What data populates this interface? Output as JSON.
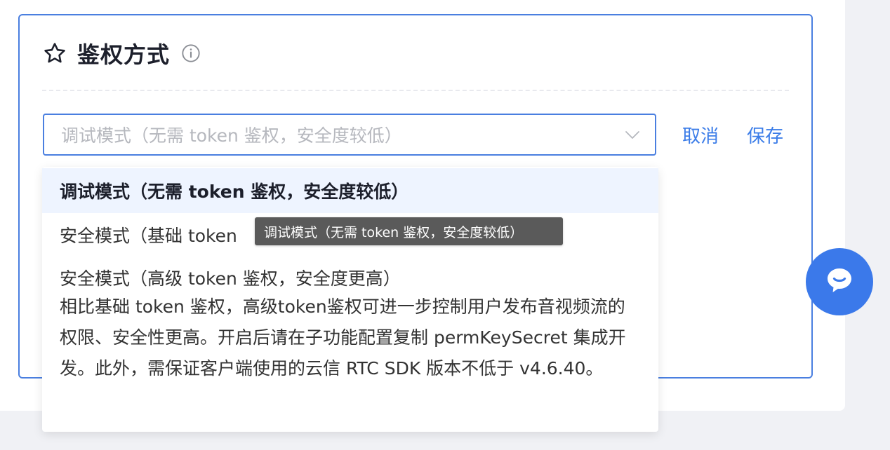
{
  "card": {
    "title": "鉴权方式"
  },
  "select": {
    "value": "调试模式（无需 token 鉴权，安全度较低）"
  },
  "actions": {
    "cancel_label": "取消",
    "save_label": "保存"
  },
  "dropdown": {
    "options": [
      {
        "label": "调试模式（无需 token 鉴权，安全度较低）",
        "highlighted": true
      },
      {
        "label": "安全模式（基础 token"
      },
      {
        "label": "安全模式（高级 token 鉴权，安全度更高）",
        "description": "相比基础 token 鉴权，高级token鉴权可进一步控制用户发布音视频流的权限、安全性更高。开启后请在子功能配置复制 permKeySecret 集成开发。此外，需保证客户端使用的云信 RTC SDK 版本不低于 v4.6.40。"
      }
    ]
  },
  "tooltip": {
    "text": "调试模式（无需 token 鉴权，安全度较低）"
  },
  "icons": {
    "title_icon": "star-icon",
    "help_icon": "info-icon",
    "select_icon": "chevron-down-icon",
    "fab_icon": "chat-bubble-icon"
  },
  "colors": {
    "accent": "#4a7fe0",
    "link": "#3c7de8",
    "fab": "#3b79ea",
    "highlight_bg": "#eef4ff",
    "tooltip_bg": "#5a5a5a"
  }
}
